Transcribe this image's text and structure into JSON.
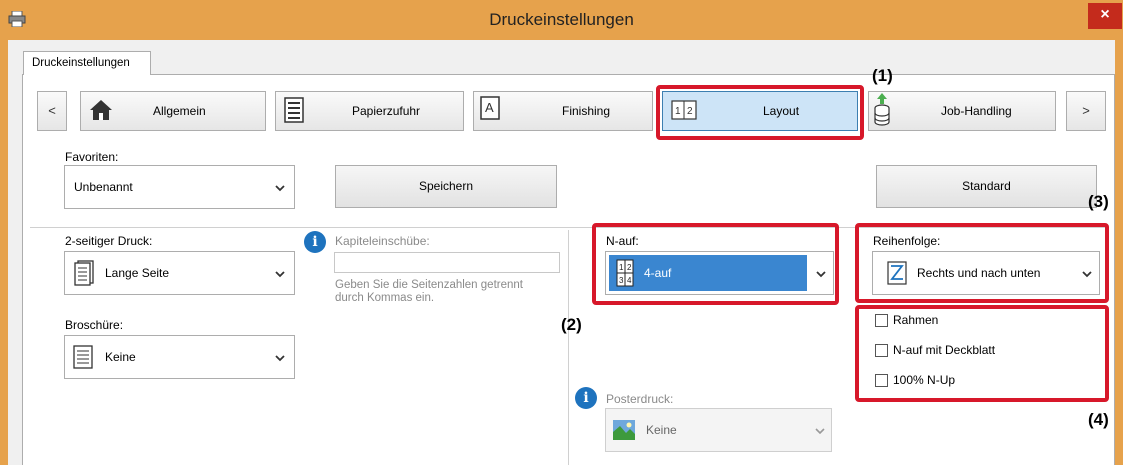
{
  "window": {
    "title": "Druckeinstellungen",
    "close_label": "×"
  },
  "tab": {
    "label": "Druckeinstellungen"
  },
  "nav": {
    "prev": "<",
    "next": ">",
    "items": [
      {
        "label": "Allgemein",
        "icon": "home-icon"
      },
      {
        "label": "Papierzufuhr",
        "icon": "paper-tray-icon"
      },
      {
        "label": "Finishing",
        "icon": "finishing-icon"
      },
      {
        "label": "Layout",
        "icon": "layout-icon",
        "active": true
      },
      {
        "label": "Job-Handling",
        "icon": "job-handling-icon"
      }
    ]
  },
  "favorites": {
    "label": "Favoriten:",
    "value": "Unbenannt",
    "save": "Speichern",
    "default": "Standard"
  },
  "duplex": {
    "label": "2-seitiger Druck:",
    "value": "Lange Seite"
  },
  "chapter": {
    "label": "Kapiteleinschübe:",
    "hint_line1": "Geben Sie die Seitenzahlen getrennt",
    "hint_line2": "durch Kommas ein."
  },
  "booklet": {
    "label": "Broschüre:",
    "value": "Keine"
  },
  "nup": {
    "label": "N-auf:",
    "value": "4-auf"
  },
  "order": {
    "label": "Reihenfolge:",
    "value": "Rechts und nach unten"
  },
  "checkboxes": [
    {
      "label": "Rahmen",
      "checked": false
    },
    {
      "label": "N-auf mit Deckblatt",
      "checked": false
    },
    {
      "label": "100% N-Up",
      "checked": false
    }
  ],
  "poster": {
    "label": "Posterdruck:",
    "value": "Keine"
  },
  "callouts": {
    "c1": "(1)",
    "c2": "(2)",
    "c3": "(3)",
    "c4": "(4)"
  },
  "colors": {
    "titlebar": "#e6a24c",
    "highlight": "#d7182a",
    "selection": "#3a86d0",
    "close": "#c42b1c"
  }
}
